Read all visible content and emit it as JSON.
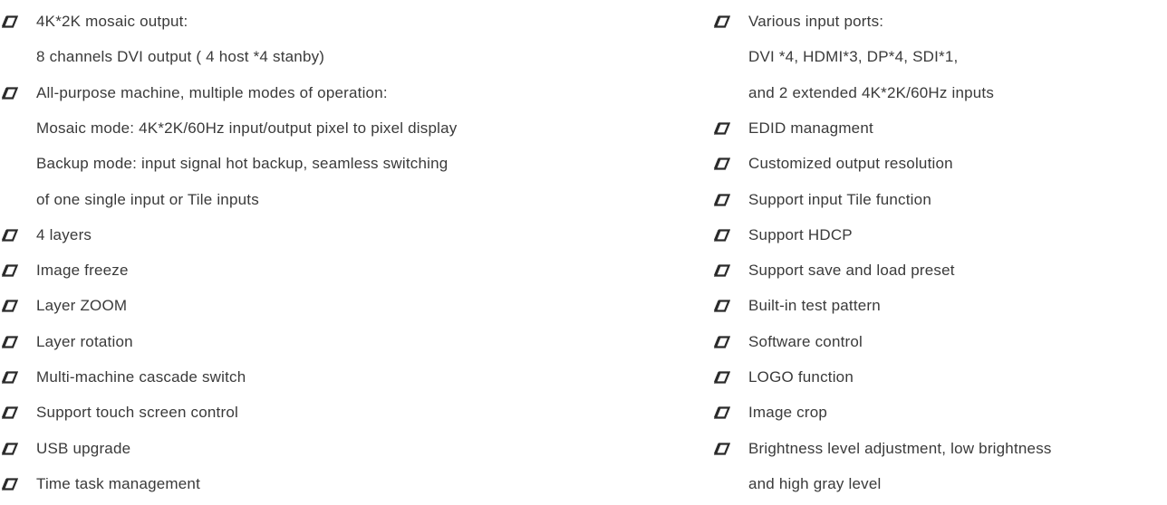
{
  "left_column": [
    {
      "bullet": true,
      "text": "4K*2K mosaic output:"
    },
    {
      "bullet": false,
      "text": "8 channels DVI output ( 4 host *4 stanby)"
    },
    {
      "bullet": true,
      "text": "All-purpose machine, multiple modes of operation:"
    },
    {
      "bullet": false,
      "text": "Mosaic mode: 4K*2K/60Hz input/output pixel to pixel display"
    },
    {
      "bullet": false,
      "text": "Backup mode: input signal hot backup, seamless switching"
    },
    {
      "bullet": false,
      "text": "of one single input or Tile inputs"
    },
    {
      "bullet": true,
      "text": "4 layers"
    },
    {
      "bullet": true,
      "text": "Image freeze"
    },
    {
      "bullet": true,
      "text": " Layer ZOOM"
    },
    {
      "bullet": true,
      "text": "Layer rotation"
    },
    {
      "bullet": true,
      "text": "Multi-machine cascade switch"
    },
    {
      "bullet": true,
      "text": "Support touch screen control"
    },
    {
      "bullet": true,
      "text": "USB upgrade"
    },
    {
      "bullet": true,
      "text": "Time task management"
    }
  ],
  "right_column": [
    {
      "bullet": true,
      "text": "Various input ports:"
    },
    {
      "bullet": false,
      "text": "DVI *4, HDMI*3, DP*4, SDI*1,"
    },
    {
      "bullet": false,
      "text": "and 2 extended 4K*2K/60Hz inputs"
    },
    {
      "bullet": true,
      "text": "EDID managment"
    },
    {
      "bullet": true,
      "text": "Customized output resolution"
    },
    {
      "bullet": true,
      "text": "Support input Tile function"
    },
    {
      "bullet": true,
      "text": "Support HDCP"
    },
    {
      "bullet": true,
      "text": "Support save and load preset"
    },
    {
      "bullet": true,
      "text": "Built-in test pattern"
    },
    {
      "bullet": true,
      "text": "Software control"
    },
    {
      "bullet": true,
      "text": " LOGO function"
    },
    {
      "bullet": true,
      "text": "Image crop"
    },
    {
      "bullet": true,
      "text": "Brightness level adjustment, low brightness"
    },
    {
      "bullet": false,
      "text": "and high gray level"
    }
  ],
  "colors": {
    "text": "#3a3a3a",
    "bullet": "#2a2a2a"
  },
  "icons": {
    "bullet": "parallelogram-bullet-icon"
  }
}
